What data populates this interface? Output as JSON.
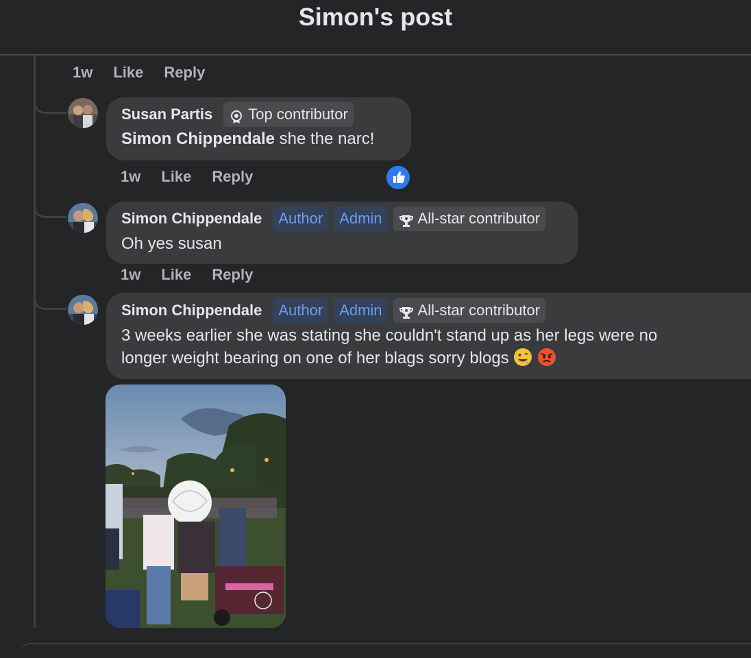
{
  "header": {
    "title": "Simon's post"
  },
  "top_meta": {
    "time": "1w",
    "like": "Like",
    "reply": "Reply"
  },
  "comments": [
    {
      "author": "Susan Partis",
      "badges": [
        {
          "label": "Top contributor",
          "icon": "contributor-badge-icon"
        }
      ],
      "mention": "Simon Chippendale",
      "text": " she the narc!",
      "time": "1w",
      "like": "Like",
      "reply": "Reply",
      "reaction": "like-reaction"
    },
    {
      "author": "Simon Chippendale",
      "badges": [
        {
          "label": "Author"
        },
        {
          "label": "Admin"
        },
        {
          "label": "All-star contributor",
          "icon": "trophy-icon"
        }
      ],
      "text": "Oh yes susan",
      "time": "1w",
      "like": "Like",
      "reply": "Reply"
    },
    {
      "author": "Simon Chippendale",
      "badges": [
        {
          "label": "Author"
        },
        {
          "label": "Admin"
        },
        {
          "label": "All-star contributor",
          "icon": "trophy-icon"
        }
      ],
      "text_line1": "3 weeks earlier she was stating she couldn't stand up as her legs were no",
      "text_line2": "longer weight bearing on one of her blags sorry blogs ",
      "emojis": [
        "drooling-face-emoji",
        "angry-face-emoji"
      ],
      "attachment": "photo"
    }
  ],
  "colors": {
    "background": "#242526",
    "bubble": "#3a3b3c",
    "badge_blue_text": "#6a9ef0",
    "like_blue": "#2e7bf0"
  }
}
